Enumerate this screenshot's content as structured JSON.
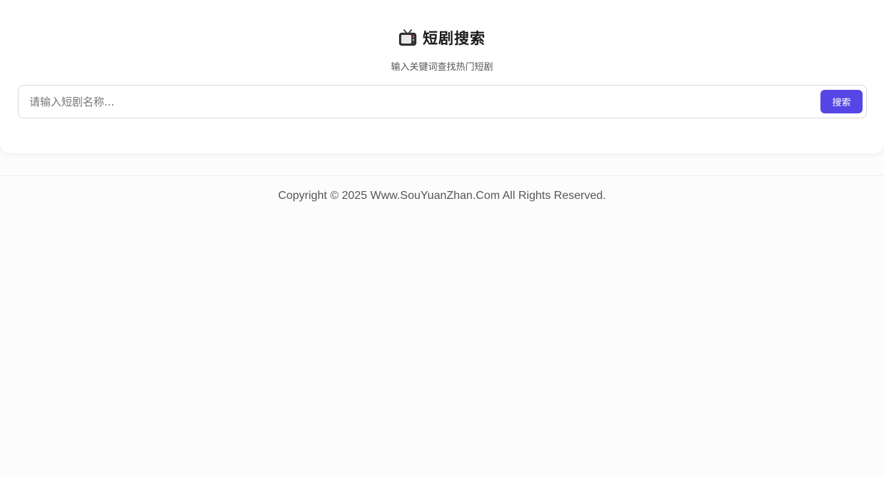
{
  "header": {
    "icon": "tv-icon",
    "title": "短剧搜索",
    "subtitle": "输入关键词查找热门短剧"
  },
  "search": {
    "placeholder": "请输入短剧名称...",
    "value": "",
    "button_label": "搜索"
  },
  "footer": {
    "copyright": "Copyright © 2025 Www.SouYuanZhan.Com All Rights Reserved."
  },
  "colors": {
    "accent": "#5646e5",
    "background": "#fdfcfd"
  }
}
